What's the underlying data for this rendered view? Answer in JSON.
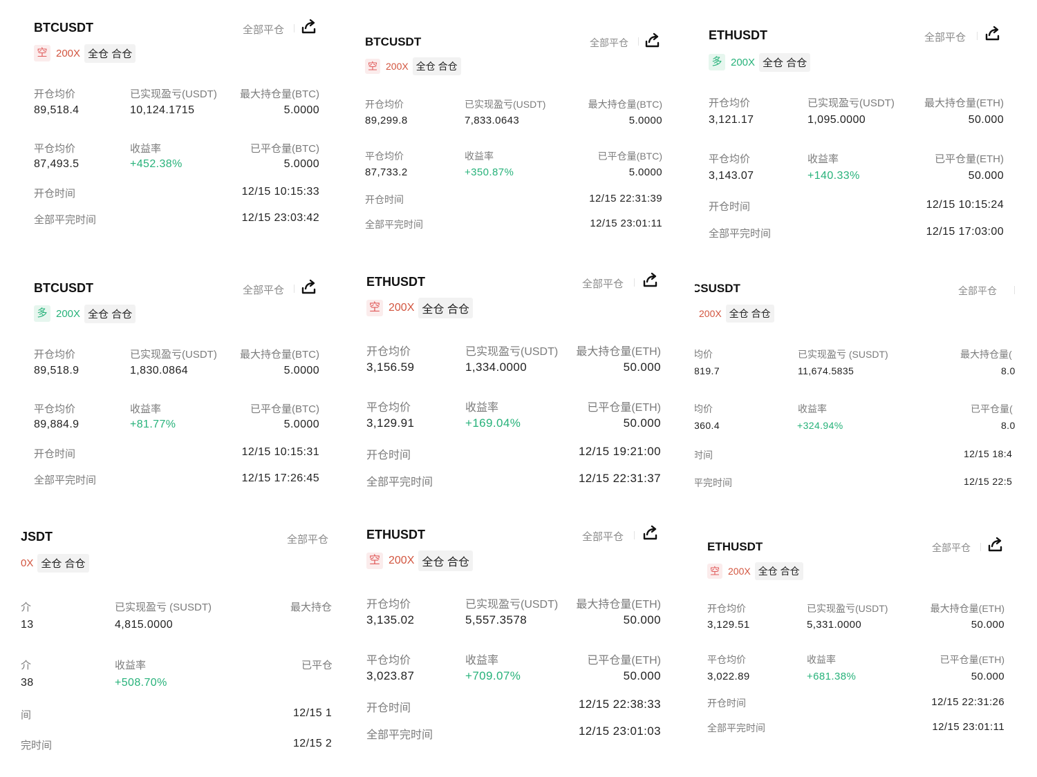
{
  "labels": {
    "close_all": "全部平仓",
    "open_avg": "开仓均价",
    "realized_pnl": "已实现盈亏(USDT)",
    "max_pos_btc": "最大持仓量(BTC)",
    "max_pos_eth": "最大持仓量(ETH)",
    "close_avg": "平仓均价",
    "yield": "收益率",
    "closed_btc": "已平仓量(BTC)",
    "closed_eth": "已平仓量(ETH)",
    "open_time": "开仓时间",
    "full_close_time": "全部平完时间",
    "margin_mode": "全仓 合仓"
  },
  "colors": {
    "short": "#e05b5b",
    "long": "#27b27a",
    "muted": "#8a8a8a"
  },
  "cards": [
    {
      "symbol": "BTCUSDT",
      "direction": "空",
      "leverage": "200X",
      "open_avg": "89,518.4",
      "realized_pnl": "10,124.1715",
      "max_pos": "5.0000",
      "close_avg": "87,493.5",
      "yield": "+452.38%",
      "closed_qty": "5.0000",
      "open_time": "12/15 10:15:33",
      "close_time": "12/15 23:03:42"
    },
    {
      "symbol": "BTCUSDT",
      "direction": "空",
      "leverage": "200X",
      "open_avg": "89,299.8",
      "realized_pnl": "7,833.0643",
      "max_pos": "5.0000",
      "close_avg": "87,733.2",
      "yield": "+350.87%",
      "closed_qty": "5.0000",
      "open_time": "12/15 22:31:39",
      "close_time": "12/15 23:01:11"
    },
    {
      "symbol": "ETHUSDT",
      "direction": "多",
      "leverage": "200X",
      "open_avg": "3,121.17",
      "realized_pnl": "1,095.0000",
      "max_pos": "50.000",
      "close_avg": "3,143.07",
      "yield": "+140.33%",
      "closed_qty": "50.000",
      "open_time": "12/15 10:15:24",
      "close_time": "12/15 17:03:00"
    },
    {
      "symbol": "BTCUSDT",
      "direction": "多",
      "leverage": "200X",
      "open_avg": "89,518.9",
      "realized_pnl": "1,830.0864",
      "max_pos": "5.0000",
      "close_avg": "89,884.9",
      "yield": "+81.77%",
      "closed_qty": "5.0000",
      "open_time": "12/15 10:15:31",
      "close_time": "12/15 17:26:45"
    },
    {
      "symbol": "ETHUSDT",
      "direction": "空",
      "leverage": "200X",
      "open_avg": "3,156.59",
      "realized_pnl": "1,334.0000",
      "max_pos": "50.000",
      "close_avg": "3,129.91",
      "yield": "+169.04%",
      "closed_qty": "50.000",
      "open_time": "12/15 19:21:00",
      "close_time": "12/15 22:31:37"
    },
    {
      "symbol": "CSUSDT",
      "direction": "",
      "leverage": "200X",
      "open_avg_label": "均价",
      "open_avg": "819.7",
      "realized_pnl_label": "已实现盈亏 (SUSDT)",
      "realized_pnl": "11,674.5835",
      "max_pos_label": "最大持仓量(",
      "max_pos": "8.0",
      "close_avg_label": "均价",
      "close_avg": "360.4",
      "yield": "+324.94%",
      "closed_label": "已平仓量(",
      "closed_qty": "8.0",
      "open_time_label": "时间",
      "open_time": "12/15 18:4",
      "close_time_label": "平完时间",
      "close_time": "12/15 22:5"
    },
    {
      "symbol": "JSDT",
      "direction": "",
      "leverage": "0X",
      "open_avg_label": "介",
      "open_avg": "13",
      "realized_pnl_label": "已实现盈亏 (SUSDT)",
      "realized_pnl": "4,815.0000",
      "max_pos_label": "最大持仓",
      "max_pos": "",
      "close_avg_label": "介",
      "close_avg": "38",
      "yield": "+508.70%",
      "closed_label": "已平仓",
      "closed_qty": "",
      "open_time_label": "间",
      "open_time": "12/15 1",
      "close_time_label": "完时间",
      "close_time": "12/15 2"
    },
    {
      "symbol": "ETHUSDT",
      "direction": "空",
      "leverage": "200X",
      "open_avg": "3,135.02",
      "realized_pnl": "5,557.3578",
      "max_pos": "50.000",
      "close_avg": "3,023.87",
      "yield": "+709.07%",
      "closed_qty": "50.000",
      "open_time": "12/15 22:38:33",
      "close_time": "12/15 23:01:03"
    },
    {
      "symbol": "ETHUSDT",
      "direction": "空",
      "leverage": "200X",
      "open_avg": "3,129.51",
      "realized_pnl": "5,331.0000",
      "max_pos": "50.000",
      "close_avg": "3,022.89",
      "yield": "+681.38%",
      "closed_qty": "50.000",
      "open_time": "12/15 22:31:26",
      "close_time": "12/15 23:01:11"
    }
  ]
}
